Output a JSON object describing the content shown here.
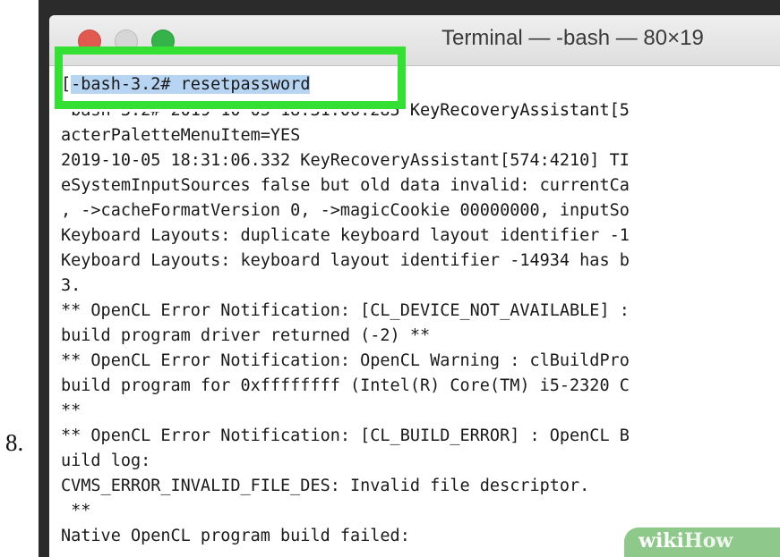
{
  "step": {
    "number": "8."
  },
  "window": {
    "title": "Terminal — -bash — 80×19",
    "buttons": {
      "close": "close-button",
      "minimize": "minimize-button",
      "zoom": "zoom-button"
    }
  },
  "terminal": {
    "prompt_bracket": "[",
    "command": "-bash-3.2# resetpassword",
    "lines": [
      "-bash-3.2# 2019-10-05 18:31:06.285 KeyRecoveryAssistant[5",
      "acterPaletteMenuItem=YES",
      "2019-10-05 18:31:06.332 KeyRecoveryAssistant[574:4210] TI",
      "eSystemInputSources false but old data invalid: currentCa",
      ", ->cacheFormatVersion 0, ->magicCookie 00000000, inputSo",
      "Keyboard Layouts: duplicate keyboard layout identifier -1",
      "Keyboard Layouts: keyboard layout identifier -14934 has b",
      "3.",
      "** OpenCL Error Notification: [CL_DEVICE_NOT_AVAILABLE] :",
      "build program driver returned (-2) **",
      "** OpenCL Error Notification: OpenCL Warning : clBuildPro",
      "build program for 0xffffffff (Intel(R) Core(TM) i5-2320 C",
      "**",
      "** OpenCL Error Notification: [CL_BUILD_ERROR] : OpenCL B",
      "uild log:",
      "CVMS_ERROR_INVALID_FILE_DES: Invalid file descriptor.",
      " **",
      "Native OpenCL program build failed:"
    ]
  },
  "watermark": {
    "part1": "wiki",
    "part2": "How"
  },
  "colors": {
    "highlight_box": "#33e033",
    "selection": "#b7d5f3",
    "close": "#e15a50",
    "zoom": "#36b24a"
  }
}
